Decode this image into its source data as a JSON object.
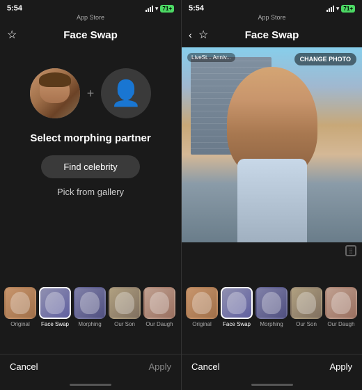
{
  "left": {
    "statusBar": {
      "time": "5:54",
      "store": "App Store",
      "battery": "71+"
    },
    "nav": {
      "title": "Face Swap",
      "starIcon": "☆"
    },
    "content": {
      "selectLabel": "Select morphing partner",
      "findCelebrityBtn": "Find celebrity",
      "pickGalleryLink": "Pick from gallery"
    },
    "filters": [
      {
        "id": "original",
        "label": "Original",
        "selected": false,
        "thumbClass": "thumb-original"
      },
      {
        "id": "faceswap",
        "label": "Face Swap",
        "selected": true,
        "thumbClass": "thumb-faceswap"
      },
      {
        "id": "morphing",
        "label": "Morphing",
        "selected": false,
        "thumbClass": "thumb-morphing"
      },
      {
        "id": "ourson",
        "label": "Our Son",
        "selected": false,
        "thumbClass": "thumb-ourson"
      },
      {
        "id": "ourdaugh",
        "label": "Our Daugh",
        "selected": false,
        "thumbClass": "thumb-ourdaugh"
      }
    ],
    "bottomBar": {
      "cancel": "Cancel",
      "apply": "Apply"
    }
  },
  "right": {
    "statusBar": {
      "time": "5:54",
      "store": "App Store",
      "battery": "71+"
    },
    "nav": {
      "title": "Face Swap",
      "backLabel": "◂",
      "starIcon": "☆"
    },
    "photo": {
      "changePhotoBtn": "CHANGE PHOTO",
      "livestreamLabel": "LiveSt... Anniv..."
    },
    "filters": [
      {
        "id": "original",
        "label": "Original",
        "selected": false,
        "thumbClass": "thumb-original"
      },
      {
        "id": "faceswap",
        "label": "Face Swap",
        "selected": true,
        "thumbClass": "thumb-faceswap"
      },
      {
        "id": "morphing",
        "label": "Morphing",
        "selected": false,
        "thumbClass": "thumb-morphing"
      },
      {
        "id": "ourson",
        "label": "Our Son",
        "selected": false,
        "thumbClass": "thumb-ourson"
      },
      {
        "id": "ourdaugh",
        "label": "Our Daugh",
        "selected": false,
        "thumbClass": "thumb-ourdaugh"
      }
    ],
    "bottomBar": {
      "cancel": "Cancel",
      "apply": "Apply"
    }
  }
}
